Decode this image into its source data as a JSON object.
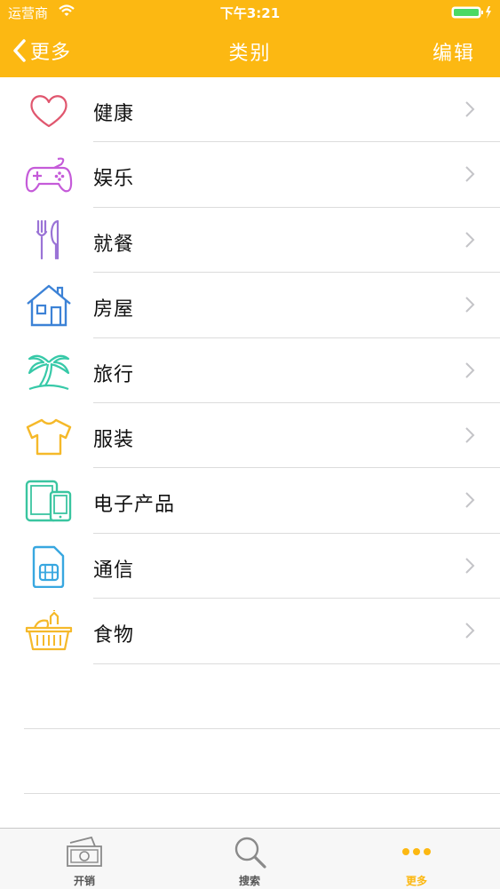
{
  "status_bar": {
    "carrier": "运营商",
    "time": "下午3:21"
  },
  "nav": {
    "back_label": "更多",
    "title": "类别",
    "edit_label": "编辑"
  },
  "colors": {
    "accent": "#fcb812",
    "separator": "#dcdcdc",
    "chevron": "#c4c4c8"
  },
  "categories": [
    {
      "label": "健康",
      "icon": "heart-icon",
      "color": "#e0566e"
    },
    {
      "label": "娱乐",
      "icon": "gamepad-icon",
      "color": "#c55bd9"
    },
    {
      "label": "就餐",
      "icon": "fork-knife-icon",
      "color": "#9a73d6"
    },
    {
      "label": "房屋",
      "icon": "house-icon",
      "color": "#3c82d6"
    },
    {
      "label": "旅行",
      "icon": "palm-tree-icon",
      "color": "#37c9a8"
    },
    {
      "label": "服装",
      "icon": "tshirt-icon",
      "color": "#f5b92a"
    },
    {
      "label": "电子产品",
      "icon": "devices-icon",
      "color": "#3ac5a0"
    },
    {
      "label": "通信",
      "icon": "sim-card-icon",
      "color": "#38a7e0"
    },
    {
      "label": "食物",
      "icon": "food-basket-icon",
      "color": "#f5b92a"
    }
  ],
  "tabs": [
    {
      "label": "开销",
      "icon": "money-icon",
      "active": false
    },
    {
      "label": "搜索",
      "icon": "search-icon",
      "active": false
    },
    {
      "label": "更多",
      "icon": "more-dots-icon",
      "active": true
    }
  ]
}
